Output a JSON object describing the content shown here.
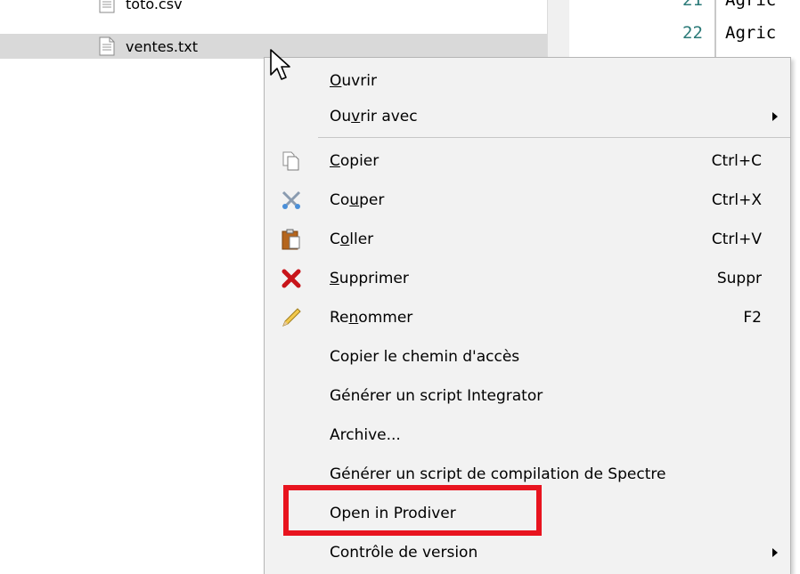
{
  "files": [
    {
      "name": "toto.csv",
      "icon": "text-file-icon",
      "selected": false
    },
    {
      "name": "ventes.txt",
      "icon": "text-file-icon",
      "selected": true
    }
  ],
  "editor": {
    "lines": [
      {
        "number": "21",
        "text": "Agric"
      },
      {
        "number": "22",
        "text": "Agric"
      }
    ]
  },
  "menu": {
    "open": {
      "pre": "",
      "ul": "O",
      "post": "uvrir"
    },
    "open_with": {
      "pre": "Ou",
      "ul": "v",
      "post": "rir avec"
    },
    "copy": {
      "pre": "",
      "ul": "C",
      "post": "opier",
      "shortcut": "Ctrl+C",
      "icon": "copy-icon"
    },
    "cut": {
      "pre": "Co",
      "ul": "u",
      "post": "per",
      "shortcut": "Ctrl+X",
      "icon": "scissors-icon"
    },
    "paste": {
      "pre": "C",
      "ul": "o",
      "post": "ller",
      "shortcut": "Ctrl+V",
      "icon": "paste-icon"
    },
    "delete": {
      "pre": "",
      "ul": "S",
      "post": "upprimer",
      "shortcut": "Suppr",
      "icon": "delete-x-icon"
    },
    "rename": {
      "pre": "Re",
      "ul": "n",
      "post": "ommer",
      "shortcut": "F2",
      "icon": "pencil-icon"
    },
    "copy_path": "Copier le chemin d'accès",
    "gen_integrator": "Générer un script Integrator",
    "archive": "Archive...",
    "gen_spectre": "Générer un script de compilation de Spectre",
    "open_prodiver": "Open in Prodiver",
    "version_control": "Contrôle de version"
  },
  "colors": {
    "menu_bg": "#f2f2f2",
    "selected_row": "#d9d9d9",
    "highlight_box": "#e8141f",
    "line_number": "#2b7a78"
  }
}
